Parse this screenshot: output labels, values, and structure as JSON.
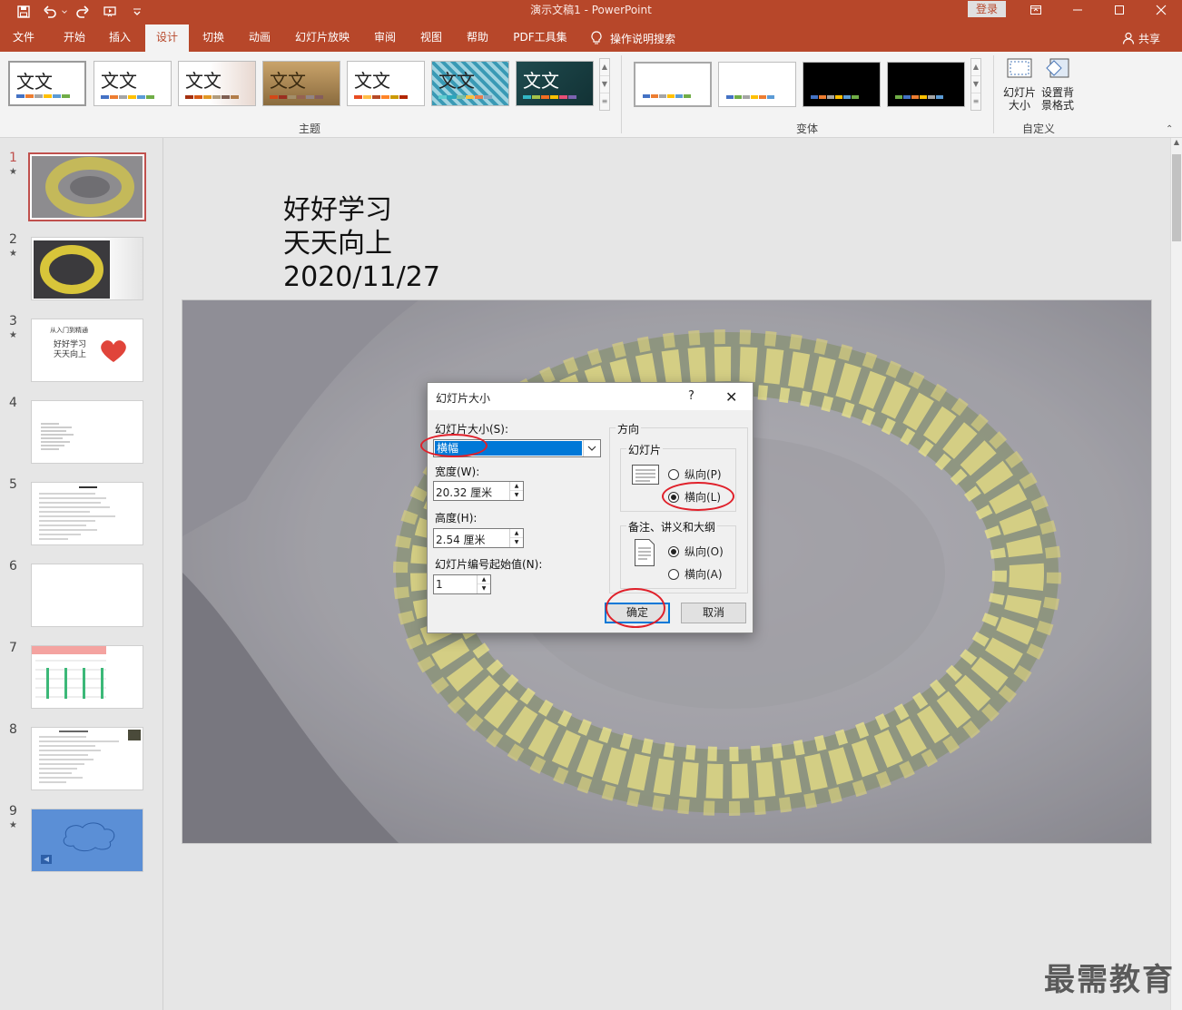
{
  "window": {
    "doc_title": "演示文稿1 - PowerPoint",
    "login": "登录"
  },
  "tabs": [
    {
      "label": "文件"
    },
    {
      "label": "开始"
    },
    {
      "label": "插入"
    },
    {
      "label": "设计"
    },
    {
      "label": "切换"
    },
    {
      "label": "动画"
    },
    {
      "label": "幻灯片放映"
    },
    {
      "label": "审阅"
    },
    {
      "label": "视图"
    },
    {
      "label": "帮助"
    },
    {
      "label": "PDF工具集"
    }
  ],
  "tell_me": "操作说明搜索",
  "share": "共享",
  "ribbon": {
    "themes_label": "主题",
    "variants_label": "变体",
    "customize_label": "自定义",
    "theme_sample": "文文",
    "slide_size_btn": "幻灯片大小",
    "format_bg_btn": "设置背景格式"
  },
  "slides": [
    {
      "num": "1",
      "star": "★"
    },
    {
      "num": "2",
      "star": "★"
    },
    {
      "num": "3",
      "star": "★"
    },
    {
      "num": "4",
      "star": ""
    },
    {
      "num": "5",
      "star": ""
    },
    {
      "num": "6",
      "star": ""
    },
    {
      "num": "7",
      "star": ""
    },
    {
      "num": "8",
      "star": ""
    },
    {
      "num": "9",
      "star": "★"
    }
  ],
  "thumb3": {
    "caption": "从入门到精通",
    "line1": "好好学习",
    "line2": "天天向上"
  },
  "slide": {
    "line1": "好好学习",
    "line2": "天天向上",
    "line3": "2020/11/27"
  },
  "dialog": {
    "title": "幻灯片大小",
    "help": "?",
    "close": "✕",
    "size_label": "幻灯片大小(S):",
    "size_value": "横幅",
    "width_label": "宽度(W):",
    "width_value": "20.32 厘米",
    "height_label": "高度(H):",
    "height_value": "2.54 厘米",
    "start_label": "幻灯片编号起始值(N):",
    "start_value": "1",
    "orientation_label": "方向",
    "slides_group": "幻灯片",
    "portrait": "纵向(P)",
    "landscape": "横向(L)",
    "notes_group": "备注、讲义和大纲",
    "notes_portrait": "纵向(O)",
    "notes_landscape": "横向(A)",
    "ok": "确定",
    "cancel": "取消"
  },
  "watermark": "最需教育",
  "colors": {
    "accent": "#b7472a",
    "selection": "#0078d7",
    "annotation": "#e0202a"
  }
}
